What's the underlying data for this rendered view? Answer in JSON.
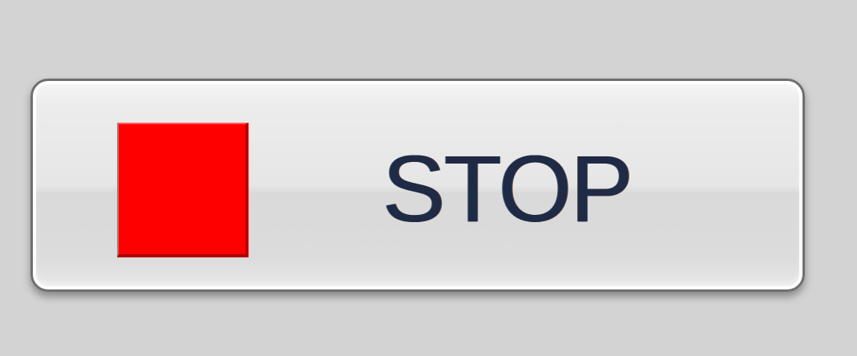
{
  "stop_button": {
    "label": "STOP",
    "icon": "stop-square-icon",
    "icon_color": "#ff0000"
  }
}
